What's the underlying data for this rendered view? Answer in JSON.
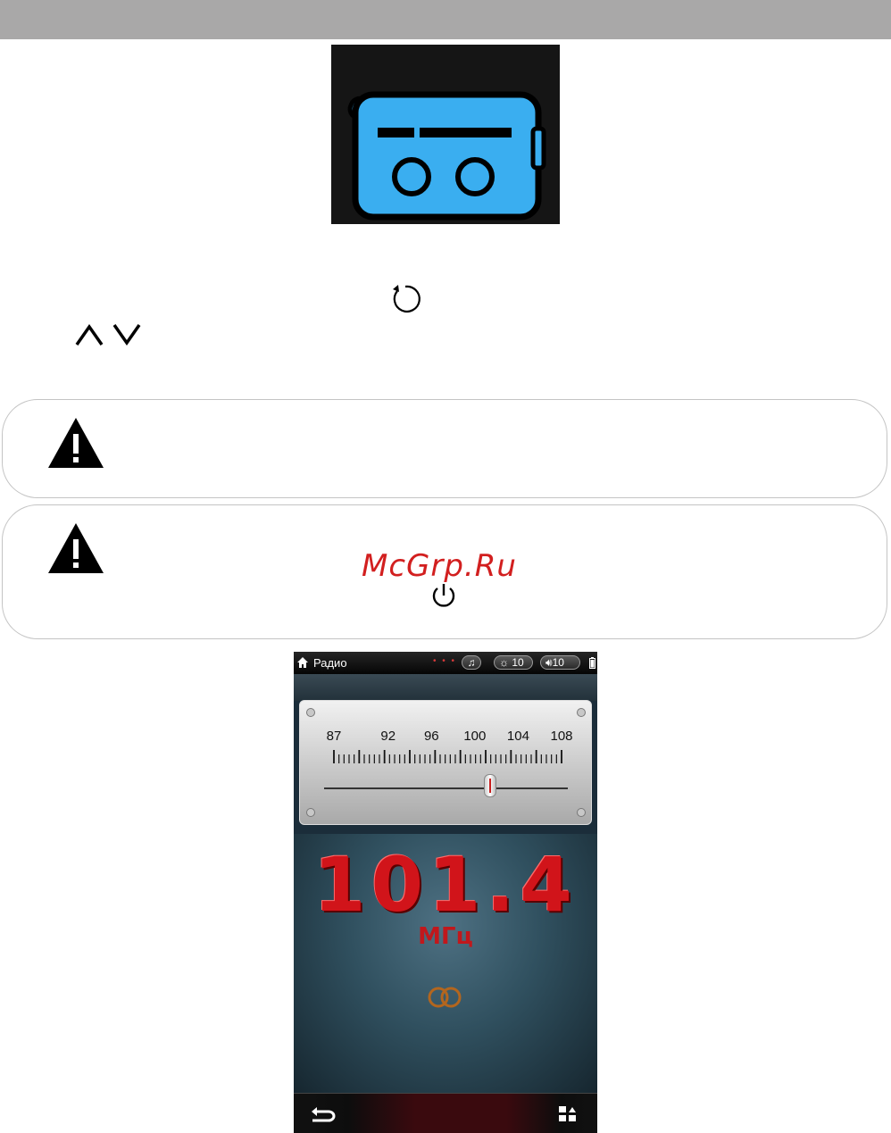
{
  "tuner": {
    "scale_labels": [
      "87",
      "92",
      "96",
      "100",
      "104",
      "108"
    ],
    "frequency": "101.4",
    "unit": "МГц",
    "slider_position": 101.4,
    "slider_range": [
      87,
      108
    ]
  },
  "status_bar": {
    "title": "Радио",
    "brightness": "10",
    "volume": "10"
  },
  "watermark": "McGrp.Ru",
  "colors": {
    "frequency": "#d1141a",
    "radio_icon": "#3aaef0",
    "watermark": "#d21f1f"
  }
}
